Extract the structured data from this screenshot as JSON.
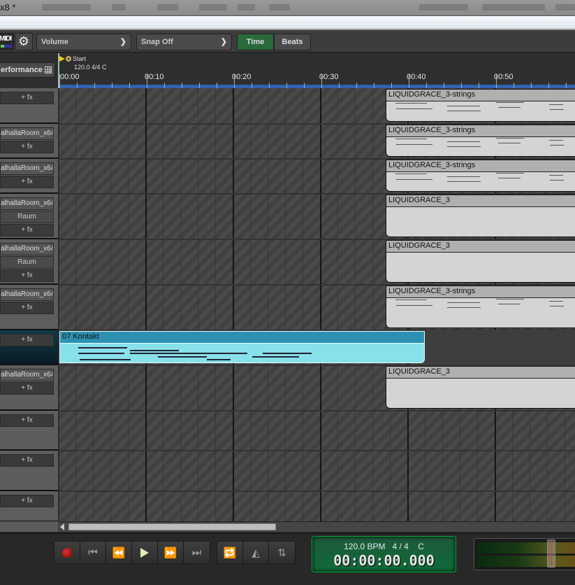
{
  "window": {
    "title": "x8 *"
  },
  "toolbar": {
    "midi_label": "MIDI",
    "automation_dropdown": "Volume",
    "snap_dropdown": "Snap Off",
    "time_mode": {
      "time_label": "Time",
      "beats_label": "Beats",
      "active": "Time"
    }
  },
  "ruler": {
    "performance_label": "erformance",
    "marker": {
      "name": "Start",
      "info": "120.0 4/4 C"
    },
    "ticks": [
      "00:00",
      "00:10",
      "00:20",
      "00:30",
      "00:40",
      "00:50"
    ]
  },
  "tracks": [
    {
      "plugin": "",
      "fx": "+ fx",
      "raum": ""
    },
    {
      "plugin": "alhallaRoom_x64",
      "fx": "+ fx",
      "raum": ""
    },
    {
      "plugin": "alhallaRoom_x64",
      "fx": "+ fx",
      "raum": ""
    },
    {
      "plugin": "alhallaRoom_x64",
      "fx": "+ fx",
      "raum": "Raum"
    },
    {
      "plugin": "alhallaRoom_x64",
      "fx": "+ fx",
      "raum": "Raum"
    },
    {
      "plugin": "alhallaRoom_x64",
      "fx": "+ fx",
      "raum": ""
    },
    {
      "plugin": "",
      "fx": "+ fx",
      "raum": "",
      "selected": true
    },
    {
      "plugin": "alhallaRoom_x64",
      "fx": "+ fx",
      "raum": ""
    },
    {
      "plugin": "",
      "fx": "+ fx",
      "raum": ""
    },
    {
      "plugin": "",
      "fx": "+ fx",
      "raum": ""
    },
    {
      "plugin": "",
      "fx": "+ fx",
      "raum": ""
    }
  ],
  "clips": [
    {
      "track": 0,
      "name": "LIQUIDGRACE_3-strings"
    },
    {
      "track": 1,
      "name": "LIQUIDGRACE_3-strings"
    },
    {
      "track": 2,
      "name": "LIQUIDGRACE_3-strings"
    },
    {
      "track": 3,
      "name": "LIQUIDGRACE_3"
    },
    {
      "track": 4,
      "name": "LIQUIDGRACE_3"
    },
    {
      "track": 5,
      "name": "LIQUIDGRACE_3-strings"
    },
    {
      "track": 6,
      "name": "07 Kontakt"
    },
    {
      "track": 7,
      "name": "LIQUIDGRACE_3"
    }
  ],
  "transport": {
    "bpm": "120.0 BPM",
    "signature": "4 / 4",
    "key": "C",
    "time": "00:00:00.000",
    "master_level": 0.72
  },
  "colors": {
    "accent_time": "#2a6a3a",
    "kontakt_clip": "#88e0ea",
    "kontakt_title": "#2e90b0",
    "ruler_bar": "#2e63b3"
  }
}
